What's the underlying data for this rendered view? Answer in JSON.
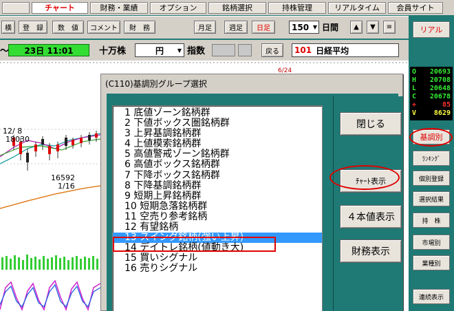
{
  "menu": [
    {
      "label": "",
      "active": false
    },
    {
      "label": "チャート",
      "active": true
    },
    {
      "label": "財務・業績",
      "active": false
    },
    {
      "label": "オプション",
      "active": false
    },
    {
      "label": "銘柄選択",
      "active": false
    },
    {
      "label": "持株管理",
      "active": false
    },
    {
      "label": "リアルタイム",
      "active": false
    },
    {
      "label": "会員サイト",
      "active": false
    }
  ],
  "toolbar": {
    "b1": "横",
    "b2": "登　録",
    "b3": "数　値",
    "b4": "コメント",
    "b5": "財　務",
    "monthly": "月足",
    "weekly": "週足",
    "daily": "日足",
    "count": "150",
    "unit": "日間",
    "up": "▲",
    "down": "▼",
    "menu": "≡"
  },
  "infobar": {
    "tilde": "〜",
    "date_time": "23日 11:01",
    "lot": "十万株",
    "currency": "円",
    "index_label": "指数",
    "back": "戻る",
    "code": "101",
    "name": "日経平均"
  },
  "quote": {
    "rows": [
      {
        "k": "O",
        "v": "20693",
        "kc": "#33ee33",
        "vc": "#33ee33"
      },
      {
        "k": "H",
        "v": "20708",
        "kc": "#33ee33",
        "vc": "#33ee33"
      },
      {
        "k": "L",
        "v": "20648",
        "kc": "#33ee33",
        "vc": "#33ee33"
      },
      {
        "k": "C",
        "v": "20678",
        "kc": "#33ee33",
        "vc": "#33ee33"
      },
      {
        "k": "+",
        "v": "85",
        "kc": "#ff3030",
        "vc": "#ff3030"
      },
      {
        "k": "V",
        "v": "8629",
        "kc": "#ffff40",
        "vc": "#ffff40"
      }
    ]
  },
  "right_panel": {
    "real": "リアル",
    "trend": "基調別",
    "ranking": "ﾗﾝｷﾝｸﾞ",
    "register": "個別登録",
    "results": "選択結果",
    "holdings": "持　株",
    "market": "市場別",
    "industry": "業種別",
    "continuous": "連続表示"
  },
  "chart_labels": {
    "peak_date": "12/ 8",
    "peak_value": "18030",
    "low_value": "16592",
    "low_date": "1/16",
    "top_mark": "6/24"
  },
  "dialog": {
    "title": "(C110)基調別グループ選択",
    "items": [
      "1  底値ゾーン銘柄群",
      "2  下値ボックス圏銘柄群",
      "3  上昇基調銘柄群",
      "4  上値模索銘柄群",
      "5  高値警戒ゾーン銘柄群",
      "6  高値ボックス銘柄群",
      "7  下降ボックス銘柄群",
      "8  下降基調銘柄群",
      "9  短期上昇銘柄群",
      "10  短期急落銘柄群",
      "11  空売り参考銘柄",
      "12  有望銘柄",
      "13  スイング銘柄(強い上昇)",
      "14  デイトレ銘柄(値動き大)",
      "15  買いシグナル",
      "16  売りシグナル"
    ],
    "selected_index": 12,
    "close": "閉じる",
    "chart_view": "ﾁｬｰﾄ表示",
    "four_values": "４本値表示",
    "financials": "財務表示"
  },
  "colors": {
    "teal": "#1f7a75",
    "highlight": "#e00000",
    "selection": "#3399ff"
  }
}
